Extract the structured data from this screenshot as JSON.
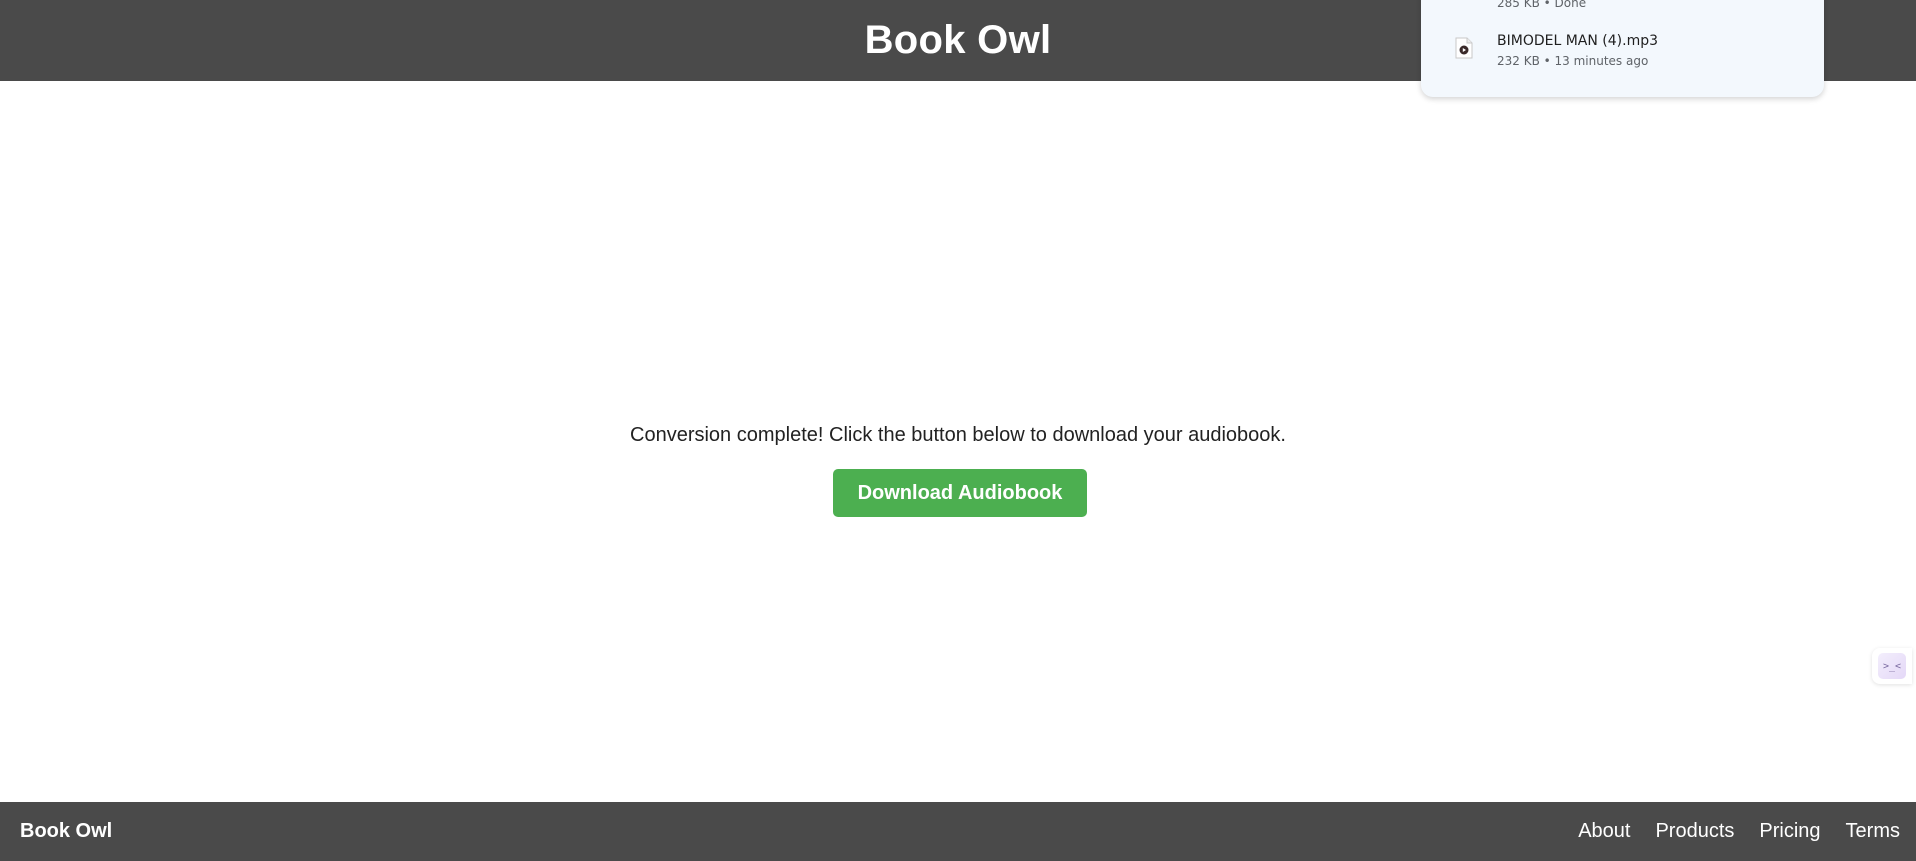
{
  "header": {
    "title": "Book Owl"
  },
  "main": {
    "message": "Conversion complete! Click the button below to download your audiobook.",
    "download_button": "Download Audiobook"
  },
  "footer": {
    "brand": "Book Owl",
    "links": [
      "About",
      "Products",
      "Pricing",
      "Terms"
    ]
  },
  "downloads": {
    "previous_item_meta": "285 KB • Done",
    "item": {
      "name": "BIMODEL MAN (4).mp3",
      "meta": "232 KB • 13 minutes ago",
      "icon": "audio-file-icon"
    }
  },
  "side_widget": {
    "icon": "assistant-icon",
    "glyph": ">_<"
  },
  "colors": {
    "header_bg": "#4a4a4a",
    "footer_bg": "#4a4a4a",
    "button_bg": "#4caf50",
    "panel_bg": "#f3f8fd"
  }
}
